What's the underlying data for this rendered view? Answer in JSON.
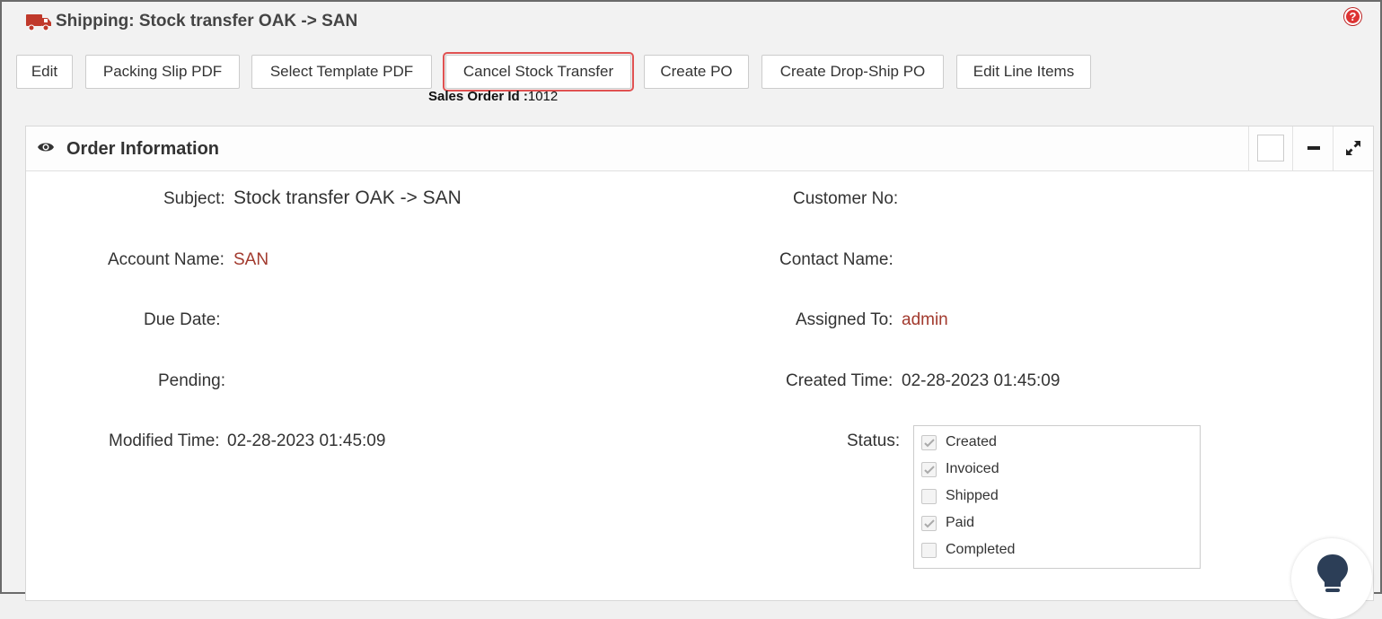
{
  "header": {
    "title": "Shipping: Stock transfer OAK -> SAN",
    "icon": "truck-icon",
    "help_icon": "help-icon",
    "accent_color": "#c0392b"
  },
  "toolbar": {
    "edit": "Edit",
    "packing_slip_pdf": "Packing Slip PDF",
    "select_template_pdf": "Select Template PDF",
    "cancel_stock_transfer": "Cancel Stock Transfer",
    "create_po": "Create PO",
    "create_drop_ship_po": "Create Drop-Ship PO",
    "edit_line_items": "Edit Line Items"
  },
  "sales_order": {
    "label": "Sales Order Id :",
    "value": "1012"
  },
  "panel": {
    "title": "Order Information",
    "icons": [
      "eye-icon",
      "checkbox-icon",
      "minimize-icon",
      "expand-icon"
    ]
  },
  "fields": {
    "subject_label": "Subject:",
    "subject_value": "Stock transfer OAK -> SAN",
    "account_name_label": "Account Name:",
    "account_name_value": "SAN",
    "due_date_label": "Due Date:",
    "pending_label": "Pending:",
    "modified_time_label": "Modified Time:",
    "modified_time_value": "02-28-2023 01:45:09",
    "customer_no_label": "Customer No:",
    "contact_name_label": "Contact Name:",
    "assigned_to_label": "Assigned To:",
    "assigned_to_value": "admin",
    "created_time_label": "Created Time:",
    "created_time_value": "02-28-2023 01:45:09",
    "status_label": "Status:"
  },
  "status_options": [
    {
      "label": "Created",
      "checked": true
    },
    {
      "label": "Invoiced",
      "checked": true
    },
    {
      "label": "Shipped",
      "checked": false
    },
    {
      "label": "Paid",
      "checked": true
    },
    {
      "label": "Completed",
      "checked": false
    }
  ],
  "link_color": "#a23a2e",
  "help_fab_icon": "lightbulb-icon"
}
